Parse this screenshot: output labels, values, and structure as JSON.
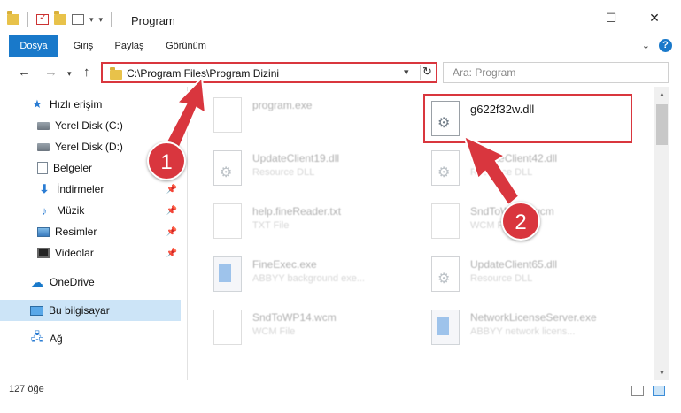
{
  "window": {
    "title": "Program",
    "minimize": "—",
    "maximize": "☐",
    "close": "✕"
  },
  "ribbon": {
    "tabs": [
      "Dosya",
      "Giriş",
      "Paylaş",
      "Görünüm"
    ],
    "active_tab": "Dosya",
    "help": "?",
    "expand": "⌄"
  },
  "address": {
    "path": "C:\\Program Files\\Program Dizini",
    "search_placeholder": "Ara: Program"
  },
  "sidebar": {
    "quick_access": "Hızlı erişim",
    "items": [
      {
        "label": "Yerel Disk (C:)",
        "icon": "disk-icon",
        "pinned": false
      },
      {
        "label": "Yerel Disk (D:)",
        "icon": "disk-icon",
        "pinned": false
      },
      {
        "label": "Belgeler",
        "icon": "documents-icon",
        "pinned": true
      },
      {
        "label": "İndirmeler",
        "icon": "downloads-icon",
        "pinned": true
      },
      {
        "label": "Müzik",
        "icon": "music-icon",
        "pinned": true
      },
      {
        "label": "Resimler",
        "icon": "pictures-icon",
        "pinned": true
      },
      {
        "label": "Videolar",
        "icon": "videos-icon",
        "pinned": true
      }
    ],
    "onedrive": "OneDrive",
    "this_pc": "Bu bilgisayar",
    "network": "Ağ"
  },
  "files": [
    {
      "name": "program.exe",
      "type": "",
      "icon": "program-icon",
      "faded": true
    },
    {
      "name": "g622f32w.dll",
      "type": "",
      "icon": "dll-icon",
      "faded": false
    },
    {
      "name": "UpdateClient19.dll",
      "type": "Resource DLL",
      "icon": "dll-icon",
      "faded": true
    },
    {
      "name": "UpdateClient42.dll",
      "type": "Resource DLL",
      "icon": "dll-icon",
      "faded": true
    },
    {
      "name": "help.fineReader.txt",
      "type": "TXT File",
      "icon": "text-file-icon",
      "faded": true
    },
    {
      "name": "SndToWP14.wcm",
      "type": "WCM File",
      "icon": "file-icon",
      "faded": true
    },
    {
      "name": "FineExec.exe",
      "type": "ABBYY background exe...",
      "icon": "exe-icon",
      "faded": true
    },
    {
      "name": "UpdateClient65.dll",
      "type": "Resource DLL",
      "icon": "dll-icon",
      "faded": true
    },
    {
      "name": "SndToWP14.wcm",
      "type": "WCM File",
      "icon": "file-icon",
      "faded": true
    },
    {
      "name": "NetworkLicenseServer.exe",
      "type": "ABBYY network licens...",
      "icon": "exe-icon",
      "faded": true
    }
  ],
  "status": {
    "count": "127 öğe"
  },
  "annotations": {
    "badge1": "1",
    "badge2": "2"
  },
  "colors": {
    "accent": "#1979ca",
    "highlight": "#d9363e",
    "selected": "#cce4f7"
  }
}
